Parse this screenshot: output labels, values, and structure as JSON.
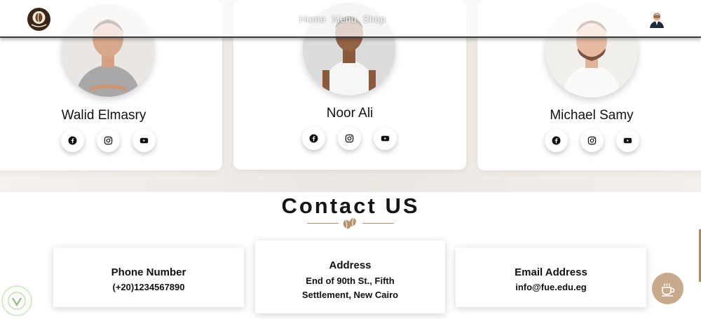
{
  "nav": {
    "links": [
      "Home",
      "Menu",
      "Shop"
    ]
  },
  "team": [
    {
      "name": "Walid Elmasry"
    },
    {
      "name": "Noor Ali"
    },
    {
      "name": "Michael Samy"
    }
  ],
  "social_icons": [
    "facebook-icon",
    "instagram-icon",
    "youtube-icon"
  ],
  "contact": {
    "title": "Contact US",
    "phone": {
      "label": "Phone Number",
      "value": "(+20)1234567890"
    },
    "address": {
      "label": "Address",
      "value": "End of 90th St., Fifth Settlement, New Cairo"
    },
    "email": {
      "label": "Email Address",
      "value": "info@fue.edu.eg"
    }
  },
  "colors": {
    "accent": "#c7a98c",
    "divider": "#b39468",
    "navbar_border": "#3b3b3b"
  }
}
